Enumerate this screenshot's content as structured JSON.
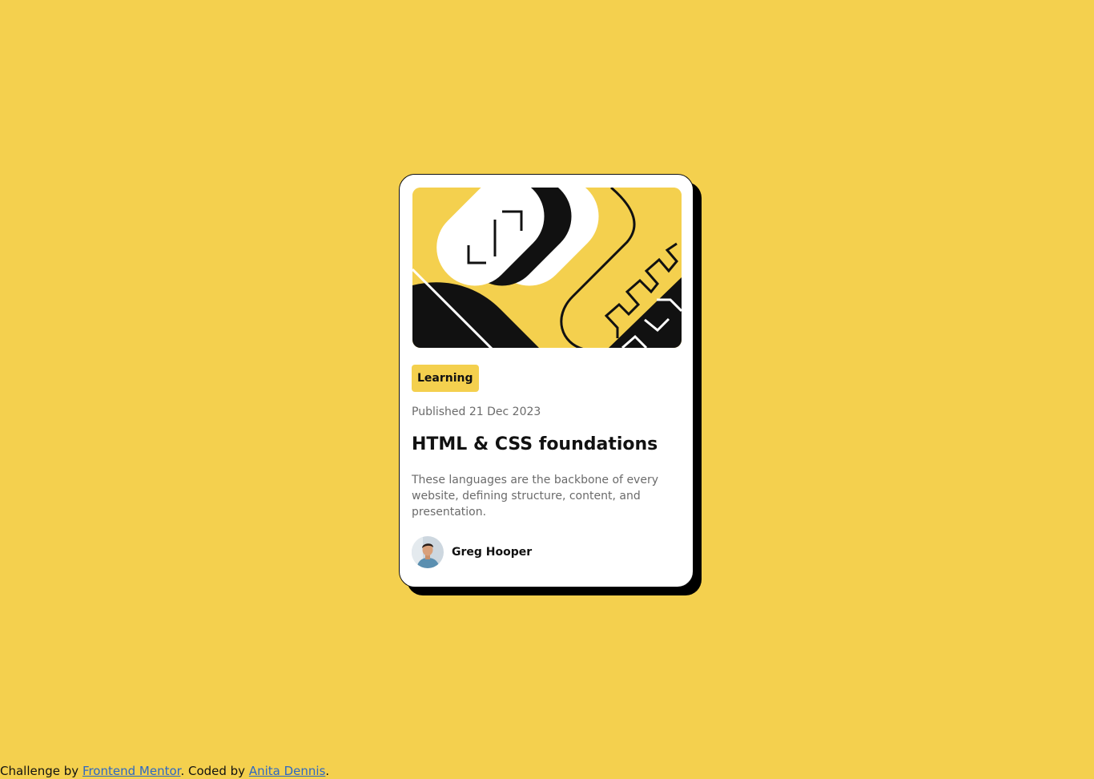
{
  "colors": {
    "background": "#f4d04e",
    "card": "#ffffff",
    "ink": "#111111",
    "muted": "#6b6b6b",
    "link": "#2d68c4"
  },
  "card": {
    "hero_icon": "code-illustration-icon",
    "tag": "Learning",
    "published": "Published 21 Dec 2023",
    "title": "HTML & CSS foundations",
    "description": "These languages are the backbone of every website, defining structure, content, and presentation.",
    "author": {
      "avatar_icon": "avatar-photo",
      "name": "Greg Hooper"
    }
  },
  "attribution": {
    "prefix": "Challenge by ",
    "challenge_link": "Frontend Mentor",
    "middle": ". Coded by ",
    "author_link": "Anita Dennis",
    "suffix": "."
  }
}
